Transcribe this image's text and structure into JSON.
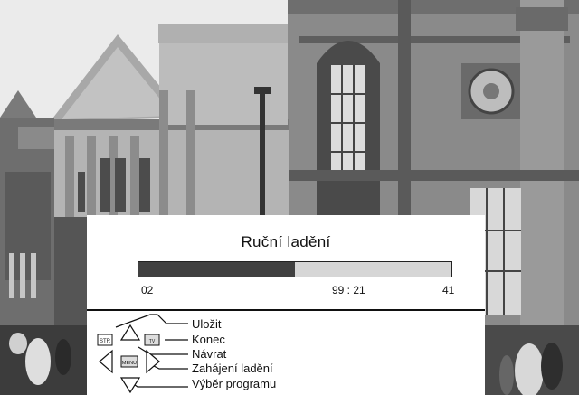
{
  "screen": {
    "title": "Ruční ladění",
    "progress": 0.5,
    "channel_number": "02",
    "frequency": "99 : 21",
    "program_number": "41"
  },
  "remote": {
    "str_key": "STR",
    "tv_key": "TV",
    "menu_key": "MENU",
    "items": [
      {
        "label": "Uložit"
      },
      {
        "label": "Konec"
      },
      {
        "label": "Návrat"
      },
      {
        "label": "Zahájení ladění"
      },
      {
        "label": "Výběr programu"
      }
    ]
  },
  "colors": {
    "bar_fill": "#404040",
    "bar_track": "#d6d6d6",
    "panel": "#ffffff"
  }
}
